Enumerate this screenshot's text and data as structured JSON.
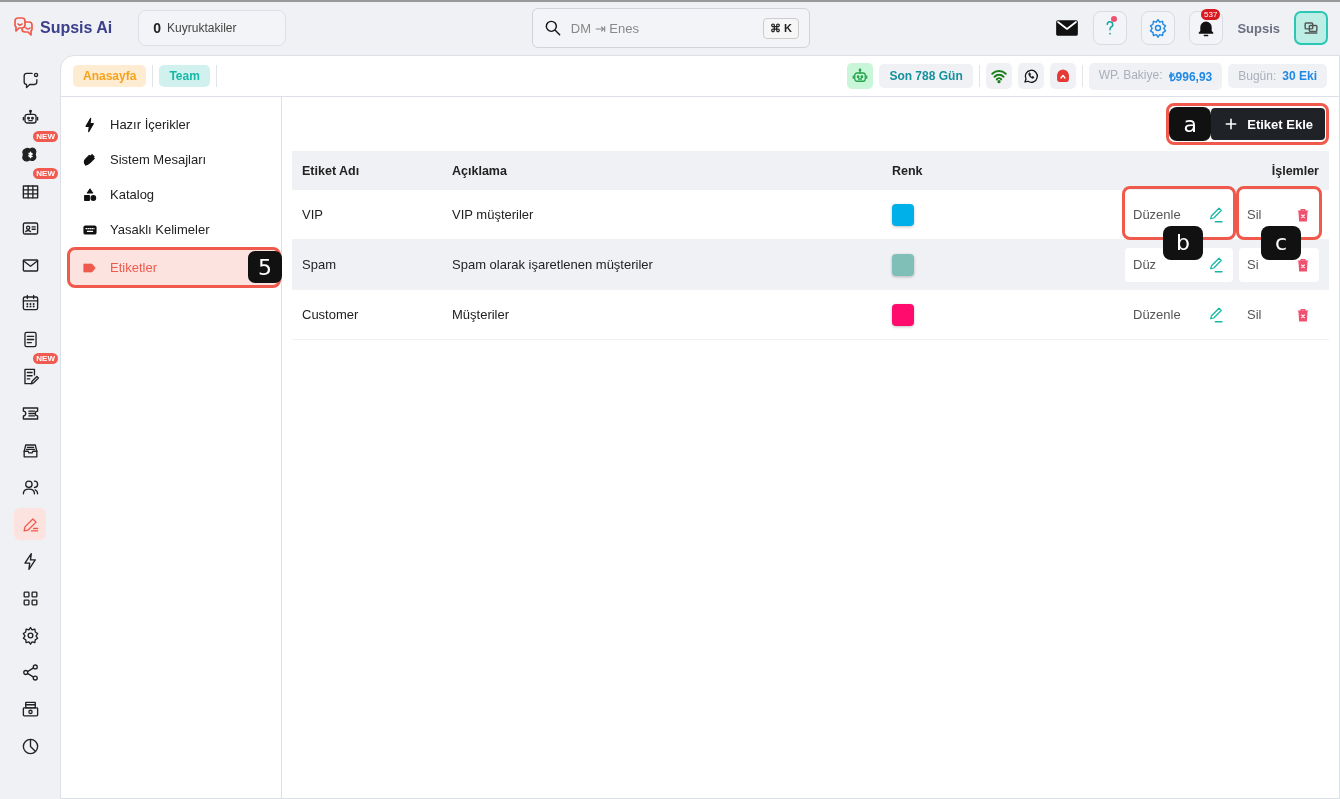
{
  "brand": {
    "name": "Supsis Ai"
  },
  "queue": {
    "count": "0",
    "label": "Kuyruktakiler"
  },
  "search": {
    "placeholder": "DM ⇥ Enes",
    "shortcut": "⌘ K"
  },
  "notifications": {
    "count": "537"
  },
  "help": {
    "dot": true
  },
  "user": {
    "name": "Supsis"
  },
  "rail": [
    {
      "selected": false
    },
    {
      "selected": false
    },
    {
      "badge": "NEW",
      "selected": false
    },
    {
      "badge": "NEW",
      "selected": false
    },
    {
      "selected": false
    },
    {
      "selected": false
    },
    {
      "selected": false
    },
    {
      "selected": false
    },
    {
      "badge": "NEW",
      "selected": false
    },
    {
      "selected": false
    },
    {
      "selected": false
    },
    {
      "selected": false
    },
    {
      "selected": true
    },
    {
      "selected": false
    },
    {
      "selected": false
    },
    {
      "selected": false
    },
    {
      "selected": false
    },
    {
      "selected": false
    },
    {
      "selected": false
    }
  ],
  "breadcrumb": [
    {
      "label": "Anasayfa",
      "color": "#f7a21b"
    },
    {
      "label": "Team",
      "color": "#14b8a6"
    }
  ],
  "status": {
    "days": "Son 788 Gün",
    "balance_label": "WP. Bakiye:",
    "balance": "₺996,93",
    "today_label": "Bugün:",
    "today": "30 Eki"
  },
  "menu": {
    "callout": "5",
    "items": [
      {
        "label": "Hazır İçerikler",
        "selected": false
      },
      {
        "label": "Sistem Mesajları",
        "selected": false
      },
      {
        "label": "Katalog",
        "selected": false
      },
      {
        "label": "Yasaklı Kelimeler",
        "selected": false
      },
      {
        "label": "Etiketler",
        "selected": true
      }
    ]
  },
  "add_button": {
    "label": "Etiket Ekle",
    "callout": "a"
  },
  "table": {
    "columns": [
      "Etiket Adı",
      "Açıklama",
      "Renk",
      "İşlemler"
    ],
    "rows": [
      {
        "name": "VIP",
        "description": "VIP müşteriler",
        "color": "#00b0e8",
        "edit": "Düzenle",
        "delete": "Sil",
        "highlighted": false,
        "edit_callout": "b",
        "delete_callout": "c"
      },
      {
        "name": "Spam",
        "description": "Spam olarak işaretlenen müşteriler",
        "color": "#7fbfb8",
        "edit": "Düz",
        "delete": "Si",
        "highlighted": true
      },
      {
        "name": "Customer",
        "description": "Müşteriler",
        "color": "#ff0b6e",
        "edit": "Düzenle",
        "delete": "Sil",
        "highlighted": false
      }
    ]
  }
}
